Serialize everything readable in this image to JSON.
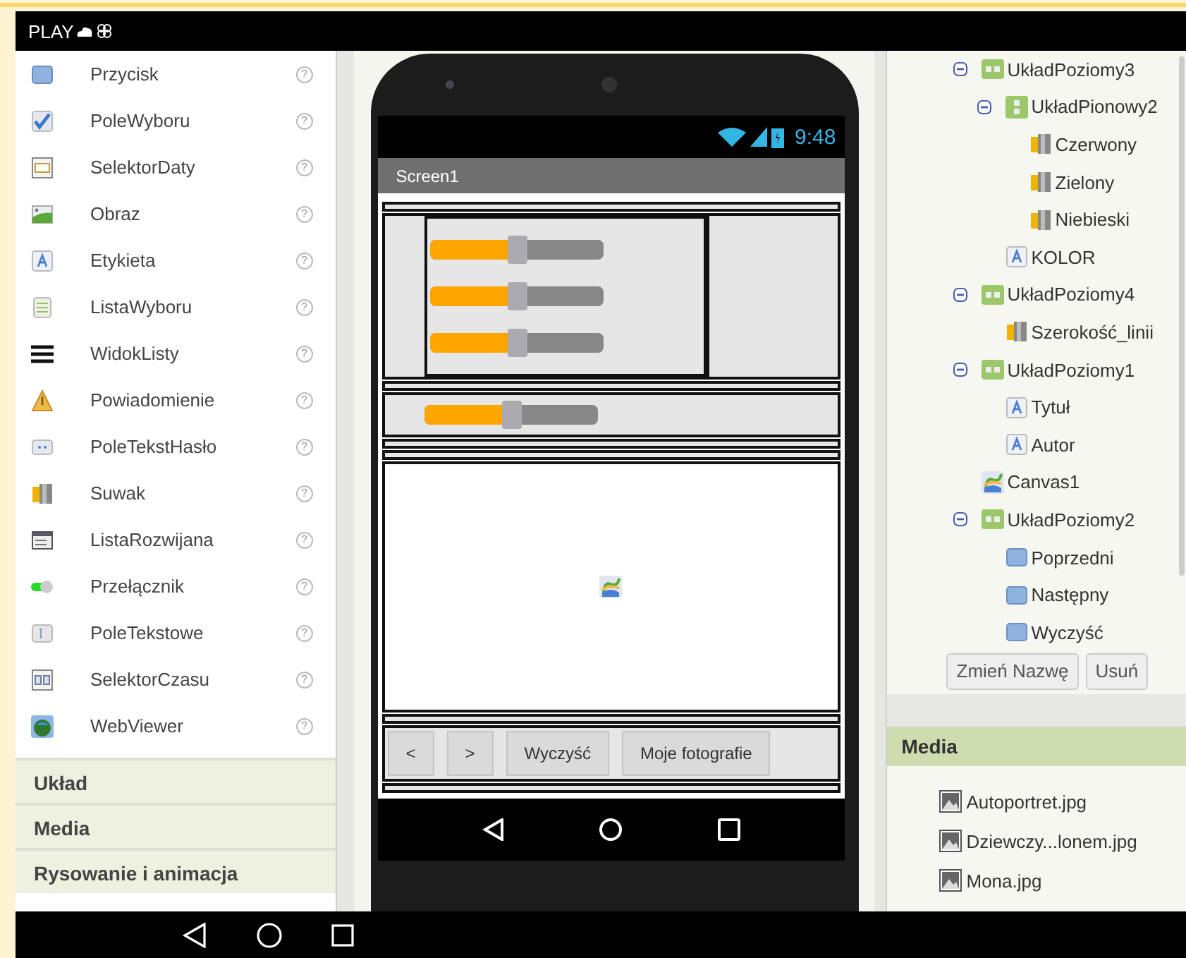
{
  "header": {
    "title": "PLAY"
  },
  "palette": {
    "items": [
      {
        "label": "Przycisk",
        "kind": "button",
        "help": "?"
      },
      {
        "label": "PoleWyboru",
        "kind": "checkbox",
        "help": "?"
      },
      {
        "label": "SelektorDaty",
        "kind": "datepicker",
        "help": "?"
      },
      {
        "label": "Obraz",
        "kind": "image",
        "help": "?"
      },
      {
        "label": "Etykieta",
        "kind": "label",
        "help": "?"
      },
      {
        "label": "ListaWyboru",
        "kind": "listpicker",
        "help": "?"
      },
      {
        "label": "WidokListy",
        "kind": "listview",
        "help": "?"
      },
      {
        "label": "Powiadomienie",
        "kind": "notifier",
        "help": "?"
      },
      {
        "label": "PoleTekstHasło",
        "kind": "password",
        "help": "?"
      },
      {
        "label": "Suwak",
        "kind": "slider",
        "help": "?"
      },
      {
        "label": "ListaRozwijana",
        "kind": "spinner",
        "help": "?"
      },
      {
        "label": "Przełącznik",
        "kind": "switch",
        "help": "?"
      },
      {
        "label": "PoleTekstowe",
        "kind": "textbox",
        "help": "?"
      },
      {
        "label": "SelektorCzasu",
        "kind": "timepicker",
        "help": "?"
      },
      {
        "label": "WebViewer",
        "kind": "webviewer",
        "help": "?"
      }
    ],
    "sections": [
      "Układ",
      "Media",
      "Rysowanie i animacja"
    ]
  },
  "phone": {
    "time": "9:48",
    "screen_title": "Screen1",
    "sliders": [
      {
        "level": 0.5
      },
      {
        "level": 0.5
      },
      {
        "level": 0.5
      }
    ],
    "width_slider": {
      "level": 0.5
    },
    "buttons": [
      "<",
      ">",
      "Wyczyść",
      "Moje fotografie"
    ]
  },
  "tree": {
    "items": [
      {
        "label": "UkładPoziomy3",
        "kind": "horizontal",
        "expanded": true,
        "children": [
          {
            "label": "UkładPionowy2",
            "kind": "vertical",
            "expanded": true,
            "children": [
              {
                "label": "Czerwony",
                "kind": "slider"
              },
              {
                "label": "Zielony",
                "kind": "slider"
              },
              {
                "label": "Niebieski",
                "kind": "slider"
              }
            ]
          },
          {
            "label": "KOLOR",
            "kind": "label"
          }
        ]
      },
      {
        "label": "UkładPoziomy4",
        "kind": "horizontal",
        "expanded": true,
        "children": [
          {
            "label": "Szerokość_linii",
            "kind": "slider"
          }
        ]
      },
      {
        "label": "UkładPoziomy1",
        "kind": "horizontal",
        "expanded": true,
        "children": [
          {
            "label": "Tytuł",
            "kind": "label"
          },
          {
            "label": "Autor",
            "kind": "label"
          }
        ]
      },
      {
        "label": "Canvas1",
        "kind": "canvas"
      },
      {
        "label": "UkładPoziomy2",
        "kind": "horizontal",
        "expanded": true,
        "children": [
          {
            "label": "Poprzedni",
            "kind": "button"
          },
          {
            "label": "Następny",
            "kind": "button"
          },
          {
            "label": "Wyczyść",
            "kind": "button"
          }
        ]
      }
    ]
  },
  "tree_buttons": [
    "Zmień Nazwę",
    "Usuń"
  ],
  "media": {
    "title": "Media",
    "files": [
      "Autoportret.jpg",
      "Dziewczy...lonem.jpg",
      "Mona.jpg"
    ]
  }
}
